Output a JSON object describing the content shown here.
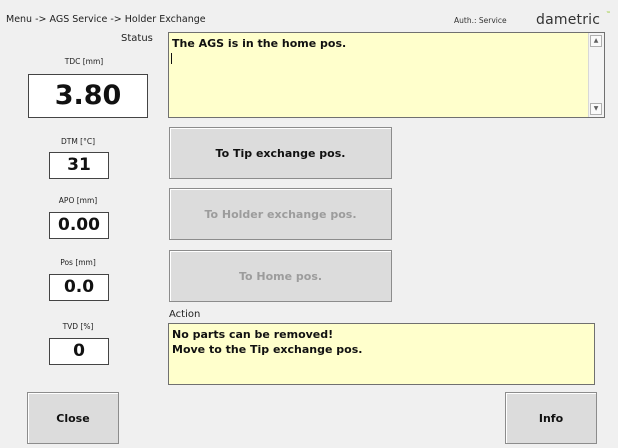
{
  "header": {
    "breadcrumb": "Menu -> AGS Service -> Holder Exchange",
    "auth": "Auth.: Service",
    "logo": "dametric",
    "logo_mark": "™"
  },
  "status": {
    "label": "Status",
    "text": "The AGS is in the home pos."
  },
  "readouts": [
    {
      "label": "TDC [mm]",
      "value": "3.80"
    },
    {
      "label": "DTM [°C]",
      "value": "31"
    },
    {
      "label": "APO [mm]",
      "value": "0.00"
    },
    {
      "label": "Pos [mm]",
      "value": "0.0"
    },
    {
      "label": "TVD [%]",
      "value": "0"
    }
  ],
  "buttons": {
    "tip_exchange": {
      "label": "To Tip exchange pos.",
      "enabled": true
    },
    "holder_exchange": {
      "label": "To Holder exchange pos.",
      "enabled": false
    },
    "home": {
      "label": "To Home pos.",
      "enabled": false
    },
    "close": "Close",
    "info": "Info"
  },
  "action": {
    "label": "Action",
    "line1": "No parts can be removed!",
    "line2": "Move to the Tip exchange pos."
  },
  "colors": {
    "background": "#f0f0f0",
    "textbox_background": "#ffffcc",
    "button_background": "#dcdcdc",
    "disabled_text": "#9c9c9c",
    "logo_accent": "#99cc33"
  }
}
